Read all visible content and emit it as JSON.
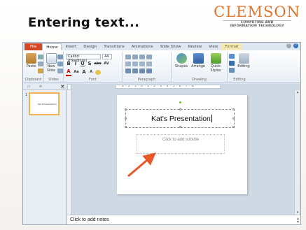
{
  "slide": {
    "title": "Entering text...",
    "logo_main": "CLEMSON",
    "logo_sub_1": "COMPUTING AND",
    "logo_sub_2": "INFORMATION TECHNOLOGY"
  },
  "ribbon": {
    "tabs": [
      "File",
      "Home",
      "Insert",
      "Design",
      "Transitions",
      "Animations",
      "Slide Show",
      "Review",
      "View",
      "Format"
    ],
    "font_name": "Calibri (Headings)",
    "font_size": "44",
    "groups": {
      "clipboard": "Clipboard",
      "slides": "Slides",
      "font": "Font",
      "paragraph": "Paragraph",
      "drawing": "Drawing",
      "editing": "Editing"
    },
    "buttons": {
      "paste": "Paste",
      "new_slide": "New Slide",
      "shapes": "Shapes",
      "arrange": "Arrange",
      "quick_styles": "Quick Styles",
      "editing": "Editing",
      "bold": "B",
      "italic": "I",
      "underline": "U",
      "shadow": "S",
      "strike": "abe",
      "spacing": "AV",
      "font_color": "A",
      "case": "Aa",
      "grow": "A",
      "shrink": "A"
    }
  },
  "thumbnail": {
    "number": "1",
    "text": "Kat's Presentation"
  },
  "ruler": {
    "label": "·3·2·1·0·1·2·3·4·5·6·7·8·"
  },
  "slide_canvas": {
    "title": "Kat's Presentation",
    "subtitle_placeholder": "Click to add subtitle"
  },
  "notes": {
    "placeholder": "Click to add notes"
  },
  "colors": {
    "accent_arrow": "#e8562a",
    "logo": "#e2742b",
    "file_tab": "#d24726"
  }
}
